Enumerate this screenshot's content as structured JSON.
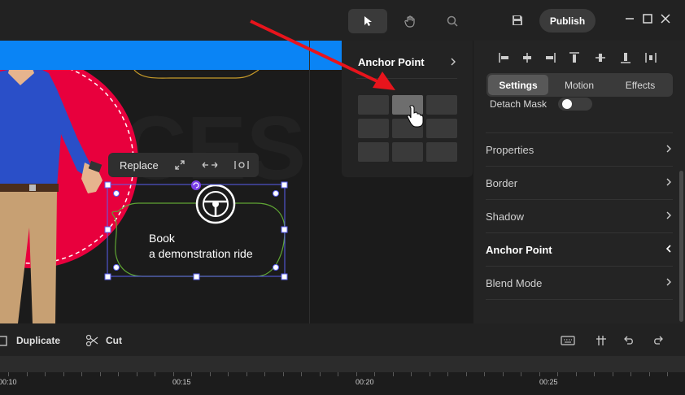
{
  "topbar": {
    "tools": [
      {
        "name": "select-tool",
        "icon": "cursor-arrow-icon"
      },
      {
        "name": "pan-tool",
        "icon": "hand-icon"
      },
      {
        "name": "zoom-tool",
        "icon": "search-icon"
      }
    ],
    "save_icon": "save-disk-icon",
    "publish_label": "Publish",
    "window_controls": [
      "minimize-icon",
      "maximize-icon",
      "close-icon"
    ]
  },
  "canvas": {
    "float_toolbar": {
      "replace_label": "Replace",
      "icons": [
        "expand-icon",
        "flip-horizontal-icon",
        "align-center-icon"
      ]
    },
    "bubble_text_line1": "Book",
    "bubble_text_line2": "a demonstration ride",
    "bubble_icon": "steering-wheel-icon",
    "colors": {
      "accent_blue": "#0a84f5",
      "circle_red": "#e8003d",
      "bubble_stroke": "#5fa534",
      "selection": "#5a5ff0"
    }
  },
  "anchor_popup": {
    "title": "Anchor Point",
    "grid_rows": 3,
    "grid_cols": 3,
    "selected_cell": "top-center"
  },
  "panel": {
    "align_icons": [
      "align-left-icon",
      "align-h-center-icon",
      "align-right-icon",
      "align-top-icon",
      "align-v-center-icon",
      "align-bottom-icon",
      "distribute-icon"
    ],
    "tabs": [
      {
        "label": "Settings",
        "active": true
      },
      {
        "label": "Motion",
        "active": false
      },
      {
        "label": "Effects",
        "active": false
      }
    ],
    "detach_mask_label": "Detach Mask",
    "rows": [
      {
        "label": "Properties",
        "expanded": false
      },
      {
        "label": "Border",
        "expanded": false
      },
      {
        "label": "Shadow",
        "expanded": false
      },
      {
        "label": "Anchor Point",
        "expanded": true
      },
      {
        "label": "Blend Mode",
        "expanded": false
      }
    ]
  },
  "bottombar": {
    "duplicate_label": "Duplicate",
    "cut_label": "Cut",
    "right_icons": [
      "keyboard-icon",
      "split-icon",
      "undo-icon",
      "redo-icon"
    ]
  },
  "timeline": {
    "labels": [
      "00:10",
      "00:15",
      "00:20",
      "00:25"
    ]
  }
}
